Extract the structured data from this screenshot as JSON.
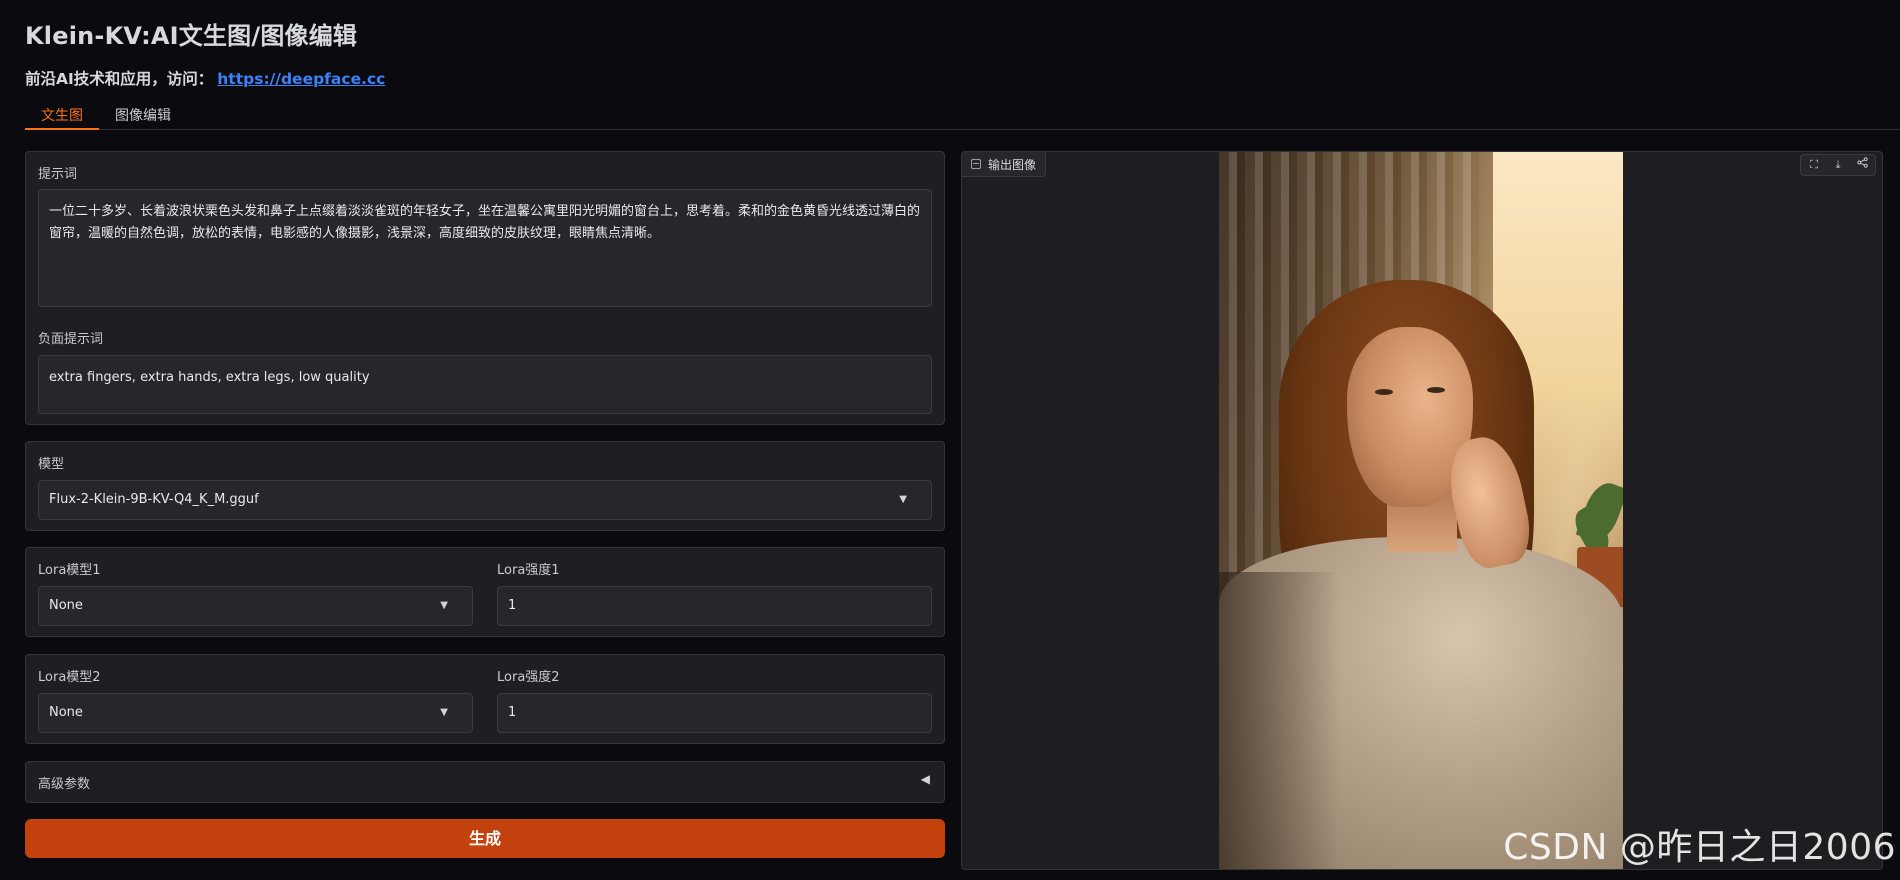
{
  "header": {
    "title": "Klein-KV:AI文生图/图像编辑",
    "subtitle_prefix": "前沿AI技术和应用，访问：",
    "subtitle_link": "https://deepface.cc"
  },
  "tabs": [
    {
      "label": "文生图",
      "active": true
    },
    {
      "label": "图像编辑",
      "active": false
    }
  ],
  "prompt": {
    "label": "提示词",
    "value": "一位二十多岁、长着波浪状栗色头发和鼻子上点缀着淡淡雀斑的年轻女子，坐在温馨公寓里阳光明媚的窗台上，思考着。柔和的金色黄昏光线透过薄白的窗帘，温暖的自然色调，放松的表情，电影感的人像摄影，浅景深，高度细致的皮肤纹理，眼睛焦点清晰。"
  },
  "negative_prompt": {
    "label": "负面提示词",
    "value": "extra fingers, extra hands, extra legs, low quality"
  },
  "model": {
    "label": "模型",
    "value": "Flux-2-Klein-9B-KV-Q4_K_M.gguf"
  },
  "lora1": {
    "model_label": "Lora模型1",
    "model_value": "None",
    "strength_label": "Lora强度1",
    "strength_value": "1"
  },
  "lora2": {
    "model_label": "Lora模型2",
    "model_value": "None",
    "strength_label": "Lora强度2",
    "strength_value": "1"
  },
  "advanced": {
    "label": "高级参数",
    "expanded": false
  },
  "generate_button": {
    "label": "生成"
  },
  "output": {
    "label": "输出图像",
    "tools": [
      "fullscreen-icon",
      "download-icon",
      "share-icon"
    ]
  },
  "watermark": "CSDN @昨日之日2006",
  "colors": {
    "background": "#0b0b0f",
    "panel": "#1f1f23",
    "accent": "#f97316",
    "button": "#c2410c",
    "link": "#3b82f6"
  }
}
